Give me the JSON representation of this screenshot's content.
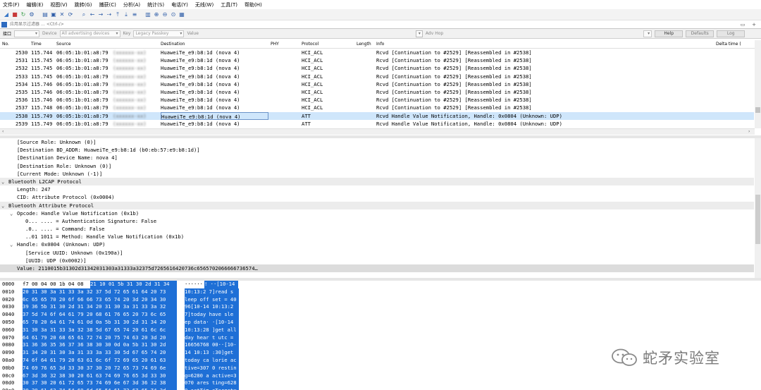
{
  "menu": [
    "文件(F)",
    "编辑(E)",
    "视图(V)",
    "跳转(G)",
    "捕获(C)",
    "分析(A)",
    "统计(S)",
    "电话(Y)",
    "无线(W)",
    "工具(T)",
    "帮助(H)"
  ],
  "toolbar_icons": [
    "shark-fin-icon",
    "stop-icon",
    "restart-icon",
    "options-icon",
    "open-icon",
    "save-icon",
    "close-file-icon",
    "reload-icon",
    "find-icon",
    "back-icon",
    "forward-icon",
    "goto-icon",
    "first-icon",
    "last-icon",
    "autoscroll-icon",
    "colorize-icon",
    "zoom-in-icon",
    "zoom-out-icon",
    "zoom-reset-icon",
    "resize-columns-icon"
  ],
  "filter": {
    "placeholder": "应用显示过滤器 … <Ctrl-/>"
  },
  "iface_bar": {
    "iface_label": "接口",
    "device_label": "Device",
    "device_value": "All advertising devices",
    "key_label": "Key",
    "key_value": "Legacy Passkey",
    "value_label": "Value",
    "adv_label": "Adv Hop",
    "help": "Help",
    "defaults": "Defaults",
    "log": "Log"
  },
  "columns": {
    "no": "No.",
    "time": "Time",
    "source": "Source",
    "destination": "Destination",
    "phy": "PHY",
    "protocol": "Protocol",
    "length": "Length",
    "info": "Info",
    "delta": "Delta time ("
  },
  "packets": [
    {
      "no": "2530",
      "time": "115.744",
      "src": "06:05:1b:01:a8:79",
      "src_name": "(xxxxxx-xx)",
      "dst": "HuaweiTe_e9:b8:1d (nova 4)",
      "proto": "HCI_ACL",
      "info": "Rcvd  [Continuation to #2529] [Reassembled in #2538]",
      "sel": false
    },
    {
      "no": "2531",
      "time": "115.745",
      "src": "06:05:1b:01:a8:79",
      "src_name": "(xxxxxx-xx)",
      "dst": "HuaweiTe_e9:b8:1d (nova 4)",
      "proto": "HCI_ACL",
      "info": "Rcvd  [Continuation to #2529] [Reassembled in #2538]",
      "sel": false
    },
    {
      "no": "2532",
      "time": "115.745",
      "src": "06:05:1b:01:a8:79",
      "src_name": "(xxxxxx-xx)",
      "dst": "HuaweiTe_e9:b8:1d (nova 4)",
      "proto": "HCI_ACL",
      "info": "Rcvd  [Continuation to #2529] [Reassembled in #2538]",
      "sel": false
    },
    {
      "no": "2533",
      "time": "115.745",
      "src": "06:05:1b:01:a8:79",
      "src_name": "(xxxxxx-xx)",
      "dst": "HuaweiTe_e9:b8:1d (nova 4)",
      "proto": "HCI_ACL",
      "info": "Rcvd  [Continuation to #2529] [Reassembled in #2538]",
      "sel": false
    },
    {
      "no": "2534",
      "time": "115.746",
      "src": "06:05:1b:01:a8:79",
      "src_name": "(xxxxxx-xx)",
      "dst": "HuaweiTe_e9:b8:1d (nova 4)",
      "proto": "HCI_ACL",
      "info": "Rcvd  [Continuation to #2529] [Reassembled in #2538]",
      "sel": false
    },
    {
      "no": "2535",
      "time": "115.746",
      "src": "06:05:1b:01:a8:79",
      "src_name": "(xxxxxx-xx)",
      "dst": "HuaweiTe_e9:b8:1d (nova 4)",
      "proto": "HCI_ACL",
      "info": "Rcvd  [Continuation to #2529] [Reassembled in #2538]",
      "sel": false
    },
    {
      "no": "2536",
      "time": "115.746",
      "src": "06:05:1b:01:a8:79",
      "src_name": "(xxxxxx-xx)",
      "dst": "HuaweiTe_e9:b8:1d (nova 4)",
      "proto": "HCI_ACL",
      "info": "Rcvd  [Continuation to #2529] [Reassembled in #2538]",
      "sel": false
    },
    {
      "no": "2537",
      "time": "115.748",
      "src": "06:05:1b:01:a8:79",
      "src_name": "(xxxxxx-xx)",
      "dst": "HuaweiTe_e9:b8:1d (nova 4)",
      "proto": "HCI_ACL",
      "info": "Rcvd  [Continuation to #2529] [Reassembled in #2538]",
      "sel": false
    },
    {
      "no": "2538",
      "time": "115.749",
      "src": "06:05:1b:01:a8:79",
      "src_name": "(xxxxxx-xx)",
      "dst": "HuaweiTe_e9:b8:1d (nova 4)",
      "proto": "ATT",
      "info": "Rcvd Handle Value Notification, Handle: 0x0804 (Unknown: UDP)",
      "sel": true
    },
    {
      "no": "2539",
      "time": "115.749",
      "src": "06:05:1b:01:a8:79",
      "src_name": "(xxxxxx-xx)",
      "dst": "HuaweiTe_e9:b8:1d (nova 4)",
      "proto": "ATT",
      "info": "Rcvd Handle Value Notification, Handle: 0x0804 (Unknown: UDP)",
      "sel": false
    }
  ],
  "details": [
    {
      "text": "[Source Role: Unknown (0)]",
      "indent": 24,
      "style": ""
    },
    {
      "text": "[Destination BD_ADDR: HuaweiTe_e9:b8:1d (b0:eb:57:e9:b8:1d)]",
      "indent": 24,
      "style": ""
    },
    {
      "text": "[Destination Device Name: nova 4]",
      "indent": 24,
      "style": ""
    },
    {
      "text": "[Destination Role: Unknown (0)]",
      "indent": 24,
      "style": ""
    },
    {
      "text": "[Current Mode: Unknown (-1)]",
      "indent": 24,
      "style": ""
    },
    {
      "text": "Bluetooth L2CAP Protocol",
      "indent": 12,
      "style": "hdr",
      "arrow": "⌄"
    },
    {
      "text": "Length: 247",
      "indent": 24,
      "style": ""
    },
    {
      "text": "CID: Attribute Protocol (0x0004)",
      "indent": 24,
      "style": ""
    },
    {
      "text": "Bluetooth Attribute Protocol",
      "indent": 12,
      "style": "hdr",
      "arrow": "⌄"
    },
    {
      "text": "Opcode: Handle Value Notification (0x1b)",
      "indent": 24,
      "style": "",
      "arrow": "⌄"
    },
    {
      "text": "0... .... = Authentication Signature: False",
      "indent": 36,
      "style": ""
    },
    {
      "text": ".0.. .... = Command: False",
      "indent": 36,
      "style": ""
    },
    {
      "text": "..01 1011 = Method: Handle Value Notification (0x1b)",
      "indent": 36,
      "style": ""
    },
    {
      "text": "Handle: 0x0804 (Unknown: UDP)",
      "indent": 24,
      "style": "",
      "arrow": "⌄"
    },
    {
      "text": "[Service UUID: Unknown (0x190a)]",
      "indent": 36,
      "style": ""
    },
    {
      "text": "[UUID: UDP (0x0002)]",
      "indent": 36,
      "style": ""
    },
    {
      "text": "Value: 2110015b31302d31342031303a31333a32375d7265616420736c6565702066666736574…",
      "indent": 24,
      "style": "sel"
    }
  ],
  "bytes": [
    {
      "off": "0000",
      "hex_pre": "f7 00 04 00 1b 04 08",
      "hex_hl": "21  10 01 5b 31 30 2d 31 34",
      "asc_pre": "······",
      "asc_hl": "! ··[10-14"
    },
    {
      "off": "0010",
      "hex_pre": "",
      "hex_hl": "20 31 30 3a 31 33 3a 32  37 5d 72 65 61 64 20 73",
      "asc_pre": "",
      "asc_hl": " 10:13:2 7]read s"
    },
    {
      "off": "0020",
      "hex_pre": "",
      "hex_hl": "6c 65 65 70 20 6f 66 66  73 65 74 20 3d 20 34 30",
      "asc_pre": "",
      "asc_hl": "leep off set = 40"
    },
    {
      "off": "0030",
      "hex_pre": "",
      "hex_hl": "39 36 5b 31 30 2d 31 34  20 31 30 3a 31 33 3a 32",
      "asc_pre": "",
      "asc_hl": "96[10-14  10:13:2"
    },
    {
      "off": "0040",
      "hex_pre": "",
      "hex_hl": "37 5d 74 6f 64 61 79 20  68 61 76 65 20 73 6c 65",
      "asc_pre": "",
      "asc_hl": "7]today  have sle"
    },
    {
      "off": "0050",
      "hex_pre": "",
      "hex_hl": "65 70 20 64 61 74 61 0d  0a 5b 31 30 2d 31 34 20",
      "asc_pre": "",
      "asc_hl": "ep data· ·[10-14 "
    },
    {
      "off": "0060",
      "hex_pre": "",
      "hex_hl": "31 30 3a 31 33 3a 32 38  5d 67 65 74 20 61 6c 6c",
      "asc_pre": "",
      "asc_hl": "10:13:28 ]get all"
    },
    {
      "off": "0070",
      "hex_pre": "",
      "hex_hl": "64 61 79 20 68 65 61 72  74 20 75 74 63 20 3d 20",
      "asc_pre": "",
      "asc_hl": "day hear t utc = "
    },
    {
      "off": "0080",
      "hex_pre": "",
      "hex_hl": "31 36 36 35 36 37 36 38  30 30 0d 0a 5b 31 30 2d",
      "asc_pre": "",
      "asc_hl": "16656768 00··[10-"
    },
    {
      "off": "0090",
      "hex_pre": "",
      "hex_hl": "31 34 20 31 30 3a 31 33  3a 33 30 5d 67 65 74 20",
      "asc_pre": "",
      "asc_hl": "14 10:13 :30]get "
    },
    {
      "off": "00a0",
      "hex_pre": "",
      "hex_hl": "74 6f 64 61 79 20 63 61  6c 6f 72 69 65 20 61 63",
      "asc_pre": "",
      "asc_hl": "today ca lorie ac"
    },
    {
      "off": "00b0",
      "hex_pre": "",
      "hex_hl": "74 69 76 65 3d 33 30 37  30 20 72 65 73 74 69 6e",
      "asc_pre": "",
      "asc_hl": "tive=307 0 restin"
    },
    {
      "off": "00c0",
      "hex_pre": "",
      "hex_hl": "67 3d 36 32 38 30 20 61  63 74 69 76 65 3d 33 30",
      "asc_pre": "",
      "asc_hl": "g=6280 a active=3"
    },
    {
      "off": "00d0",
      "hex_pre": "",
      "hex_hl": "30 37 30 20 61 72 65 73  74 69 6e 67 3d 36 32 38",
      "asc_pre": "",
      "asc_hl": "070 ares ting=628"
    },
    {
      "off": "00e0",
      "hex_pre": "",
      "hex_hl": "30 20 61 63 74 54 69 6d  65 54 61 72 67 65 74 3d",
      "asc_pre": "",
      "asc_hl": "0 actTim eTarget="
    }
  ],
  "watermark": {
    "text": "蛇矛实验室"
  }
}
